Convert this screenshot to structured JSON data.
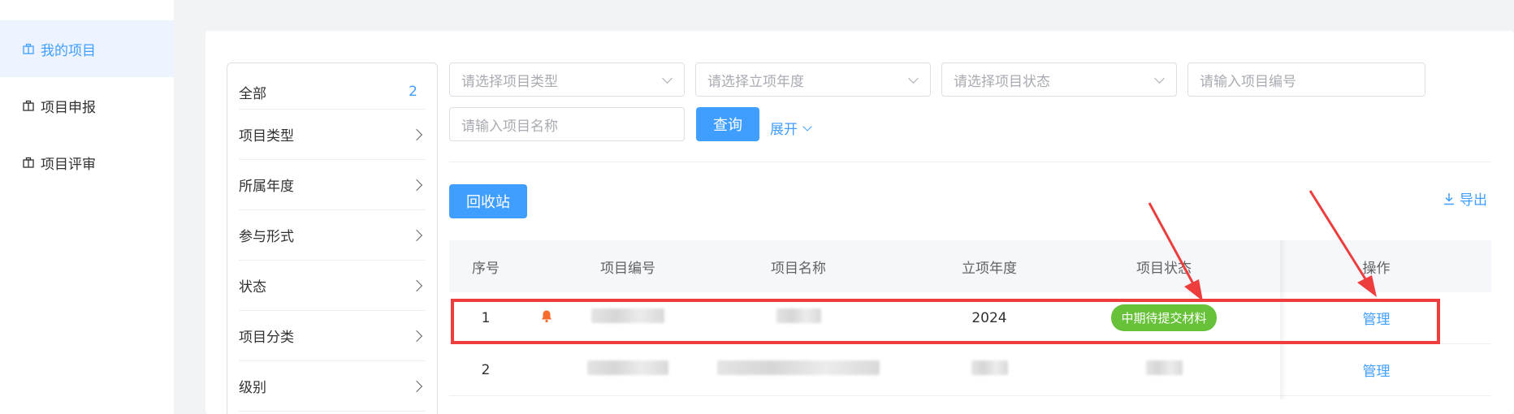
{
  "sidebar": {
    "items": [
      {
        "label": "我的项目",
        "active": true
      },
      {
        "label": "项目申报",
        "active": false
      },
      {
        "label": "项目评审",
        "active": false
      }
    ]
  },
  "filter_panel": {
    "all_label": "全部",
    "all_count": "2",
    "rows": [
      "项目类型",
      "所属年度",
      "参与形式",
      "状态",
      "项目分类",
      "级别"
    ]
  },
  "search": {
    "type_placeholder": "请选择项目类型",
    "year_placeholder": "请选择立项年度",
    "status_placeholder": "请选择项目状态",
    "code_placeholder": "请输入项目编号",
    "name_placeholder": "请输入项目名称",
    "query_label": "查询",
    "expand_label": "展开"
  },
  "toolbar": {
    "recycle_label": "回收站",
    "export_label": "导出"
  },
  "table": {
    "headers": {
      "seq": "序号",
      "code": "项目编号",
      "name": "项目名称",
      "year": "立项年度",
      "status": "项目状态",
      "op": "操作"
    },
    "rows": [
      {
        "seq": "1",
        "year": "2024",
        "status": "中期待提交材料",
        "op": "管理"
      },
      {
        "seq": "2",
        "year": "",
        "status": "",
        "op": "管理"
      }
    ]
  },
  "colors": {
    "primary": "#409eff",
    "success": "#67c23a",
    "annotation": "#ee3d3d",
    "alert": "#f56c2d"
  }
}
